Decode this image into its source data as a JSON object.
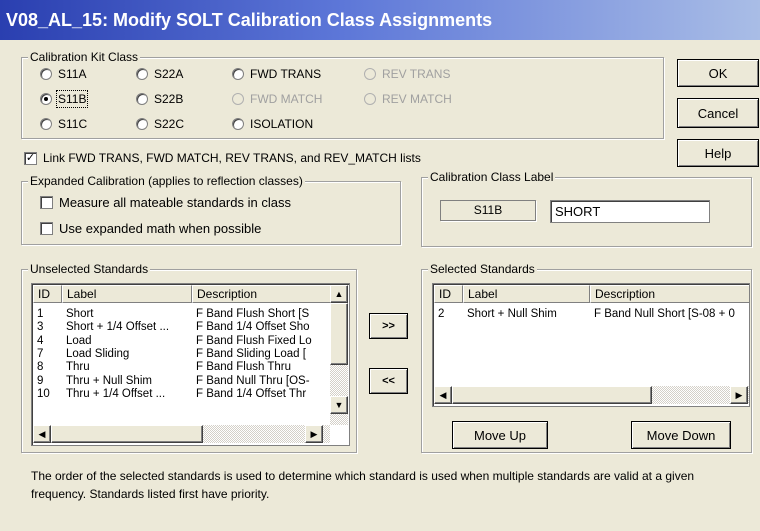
{
  "window": {
    "title": "V08_AL_15: Modify SOLT Calibration Class Assignments"
  },
  "kit_class": {
    "legend": "Calibration Kit Class",
    "options": [
      {
        "label": "S11A",
        "selected": false,
        "enabled": true
      },
      {
        "label": "S22A",
        "selected": false,
        "enabled": true
      },
      {
        "label": "FWD TRANS",
        "selected": false,
        "enabled": true
      },
      {
        "label": "REV TRANS",
        "selected": false,
        "enabled": false
      },
      {
        "label": "S11B",
        "selected": true,
        "enabled": true
      },
      {
        "label": "S22B",
        "selected": false,
        "enabled": true
      },
      {
        "label": "FWD MATCH",
        "selected": false,
        "enabled": false
      },
      {
        "label": "REV MATCH",
        "selected": false,
        "enabled": false
      },
      {
        "label": "S11C",
        "selected": false,
        "enabled": true
      },
      {
        "label": "S22C",
        "selected": false,
        "enabled": true
      },
      {
        "label": "ISOLATION",
        "selected": false,
        "enabled": true
      }
    ]
  },
  "buttons": {
    "ok": "OK",
    "cancel": "Cancel",
    "help": "Help",
    "add": ">>",
    "remove": "<<",
    "move_up": "Move Up",
    "move_down": "Move Down"
  },
  "link_lists": {
    "label": "Link FWD TRANS, FWD MATCH, REV TRANS, and REV_MATCH lists",
    "checked": true
  },
  "expanded": {
    "legend": "Expanded Calibration (applies to reflection classes)",
    "measure_all": {
      "label": "Measure all mateable standards in class",
      "checked": false
    },
    "expanded_math": {
      "label": "Use expanded math when possible",
      "checked": false
    }
  },
  "class_label": {
    "legend": "Calibration Class Label",
    "class_name": "S11B",
    "value": "SHORT"
  },
  "unselected": {
    "legend": "Unselected Standards",
    "columns": [
      "ID",
      "Label",
      "Description"
    ],
    "rows": [
      [
        "1",
        "Short",
        "F Band Flush Short [S"
      ],
      [
        "3",
        "Short + 1/4 Offset ...",
        "F Band 1/4 Offset Sho"
      ],
      [
        "4",
        "Load",
        "F Band Flush Fixed Lo"
      ],
      [
        "7",
        "Load Sliding",
        "F Band Sliding Load ["
      ],
      [
        "8",
        "Thru",
        "F Band Flush Thru"
      ],
      [
        "9",
        "Thru + Null Shim",
        "F Band Null Thru [OS-"
      ],
      [
        "10",
        "Thru + 1/4 Offset ...",
        "F Band 1/4 Offset Thr"
      ]
    ]
  },
  "selected": {
    "legend": "Selected Standards",
    "columns": [
      "ID",
      "Label",
      "Description"
    ],
    "rows": [
      [
        "2",
        "Short + Null Shim",
        "F Band Null Short [S-08 + 0"
      ]
    ]
  },
  "note": "The order of the selected standards is used to determine which standard is used when multiple standards are valid at a given frequency. Standards listed first have priority."
}
